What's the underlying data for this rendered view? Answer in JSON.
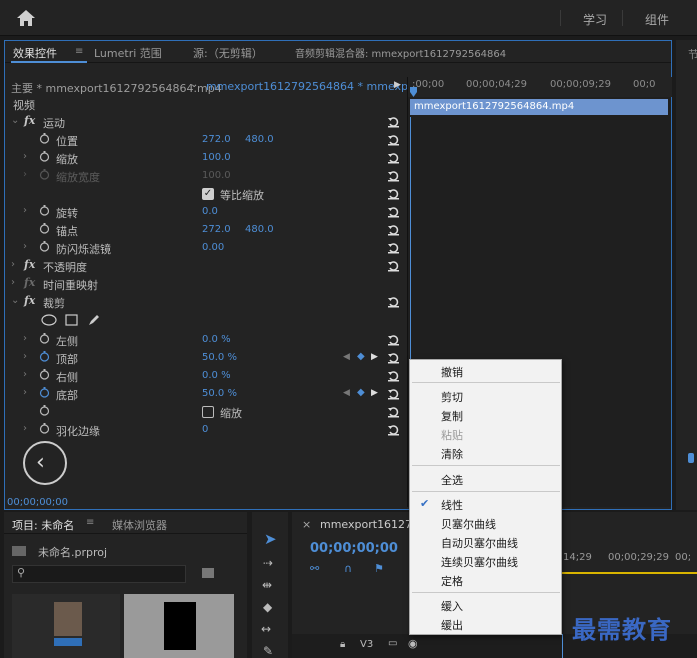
{
  "topbar": {
    "workspace_1": "学习",
    "workspace_2": "组件"
  },
  "effect_controls": {
    "tabs": [
      "效果控件",
      "Lumetri 范围",
      "源:（无剪辑）",
      "音频剪辑混合器: mmexport1612792564864"
    ],
    "source_row": {
      "master": "主要 * mmexport1612792564864.mp4",
      "sequence": "mmexport1612792564864 * mmexport..."
    },
    "section_video": "视频",
    "rows": {
      "motion": "运动",
      "position": {
        "label": "位置",
        "v1": "272.0",
        "v2": "480.0"
      },
      "scale": {
        "label": "缩放",
        "v1": "100.0"
      },
      "scale_width": {
        "label": "缩放宽度",
        "v1": "100.0"
      },
      "uniform_scale": "等比缩放",
      "rotation": {
        "label": "旋转",
        "v1": "0.0"
      },
      "anchor": {
        "label": "锚点",
        "v1": "272.0",
        "v2": "480.0"
      },
      "anti_flicker": {
        "label": "防闪烁滤镜",
        "v1": "0.00"
      },
      "opacity": "不透明度",
      "time_remap": "时间重映射",
      "crop": "裁剪",
      "left": {
        "label": "左侧",
        "v1": "0.0 %"
      },
      "top": {
        "label": "顶部",
        "v1": "50.0 %"
      },
      "right": {
        "label": "右侧",
        "v1": "0.0 %"
      },
      "bottom": {
        "label": "底部",
        "v1": "50.0 %"
      },
      "zoom": "缩放",
      "feather": {
        "label": "羽化边缘",
        "v1": "0"
      }
    },
    "timecode": "00;00;00;00",
    "ruler_ticks": [
      ":00;00",
      "00;00;04;29",
      "00;00;09;29",
      "00;0"
    ],
    "clip_name": "mmexport1612792564864.mp4"
  },
  "context_menu": {
    "items": [
      "撤销",
      "剪切",
      "复制",
      "粘贴",
      "清除",
      "全选",
      "线性",
      "贝塞尔曲线",
      "自动贝塞尔曲线",
      "连续贝塞尔曲线",
      "定格",
      "缓入",
      "缓出"
    ],
    "checked_item": "线性"
  },
  "project": {
    "tabs": [
      "项目: 未命名",
      "媒体浏览器"
    ],
    "project_file": "未命名.prproj"
  },
  "sequence": {
    "tab": "mmexport161279256",
    "timecode": "00;00;00;00",
    "ticks": [
      "14;29",
      "00;00;29;29",
      "00;"
    ],
    "track": "V3"
  },
  "watermark": "最需教育",
  "colors": {
    "accent": "#4e8ed6",
    "panel": "#232323",
    "menu_bg": "#f2f2f2"
  }
}
